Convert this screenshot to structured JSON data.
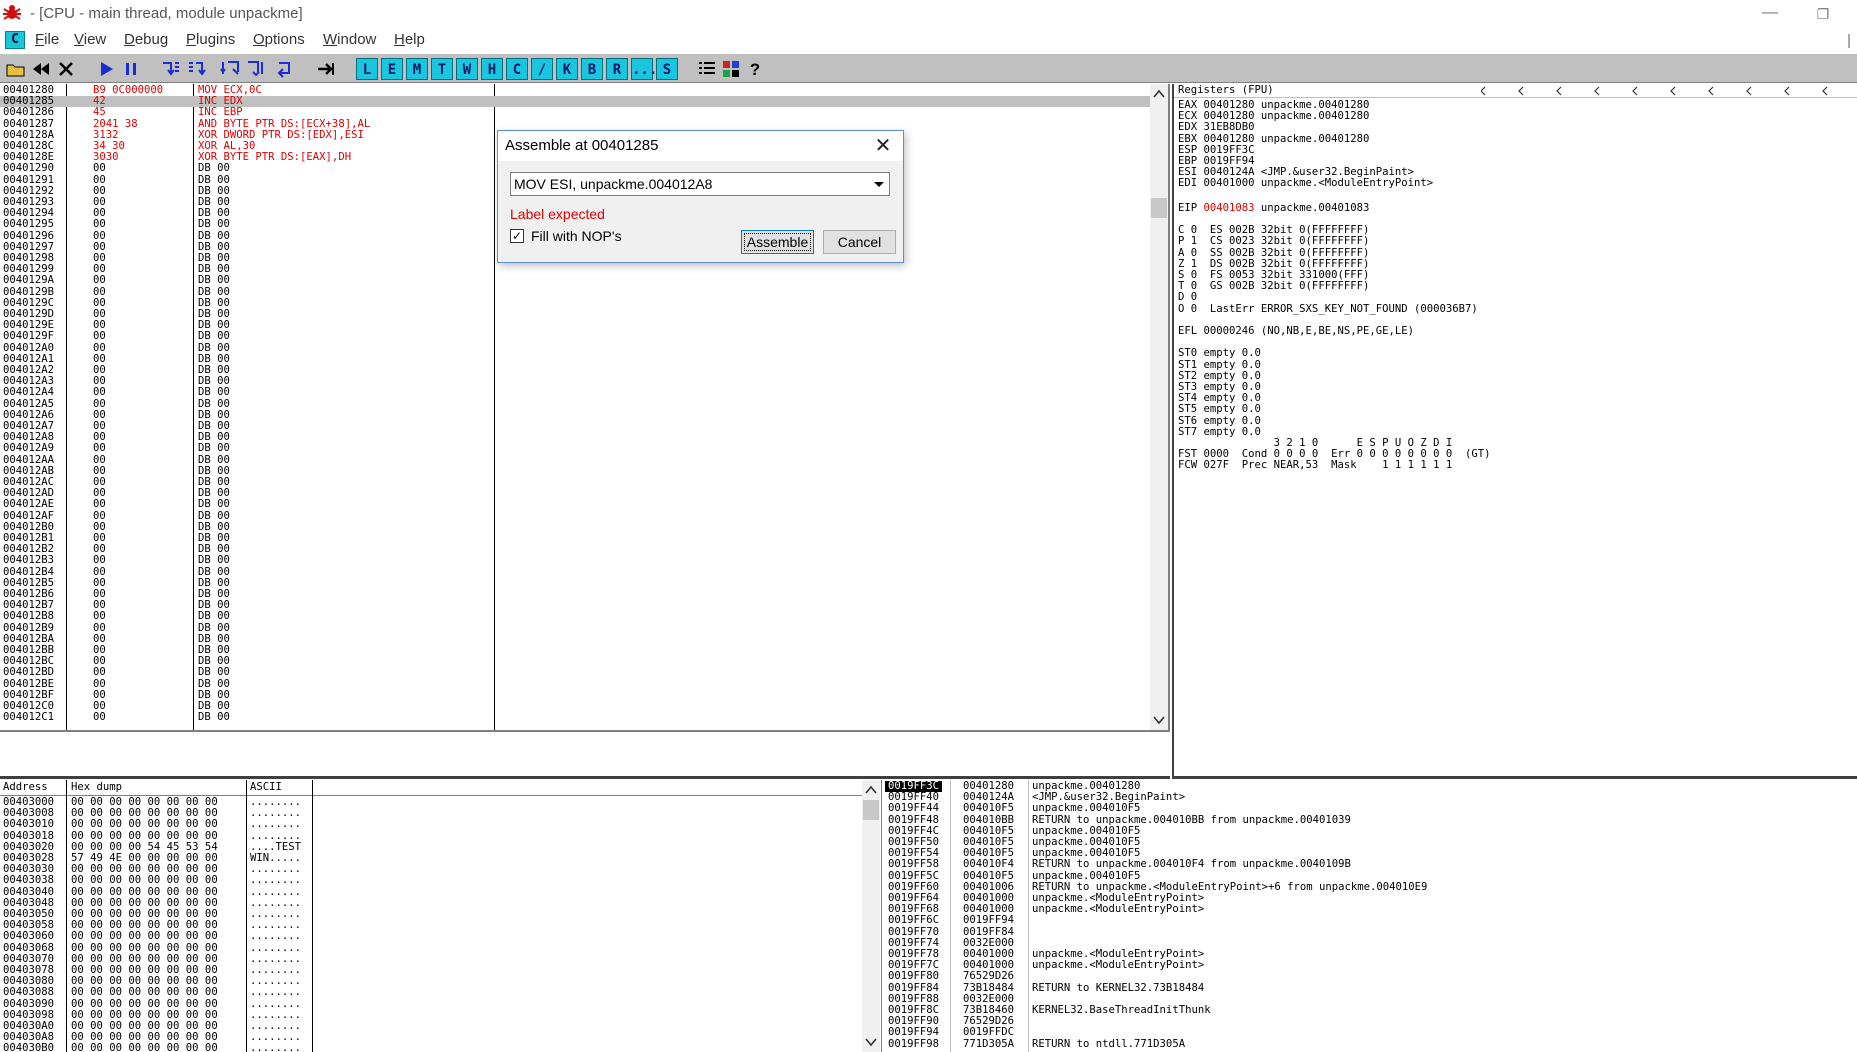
{
  "window": {
    "title": "- [CPU - main thread, module unpackme]",
    "minimize": "—",
    "restore": "❐"
  },
  "menu": {
    "icon_label": "C",
    "items": [
      {
        "first": "F",
        "rest": "ile"
      },
      {
        "first": "V",
        "rest": "iew"
      },
      {
        "first": "D",
        "rest": "ebug"
      },
      {
        "first": "P",
        "rest": "lugins"
      },
      {
        "first": "O",
        "rest": "ptions"
      },
      {
        "first": "W",
        "rest": "indow"
      },
      {
        "first": "H",
        "rest": "elp"
      }
    ]
  },
  "toolbar": {
    "icons": [
      "open-icon",
      "rewind-icon",
      "close-icon",
      "play-icon",
      "pause-icon",
      "step-into-icon",
      "step-over-icon",
      "trace-into-icon",
      "trace-over-icon",
      "execute-till-return-icon",
      "go-to-icon"
    ],
    "letters": [
      "L",
      "E",
      "M",
      "T",
      "W",
      "H",
      "C",
      "/",
      "K",
      "B",
      "R",
      "...",
      "S"
    ],
    "tail_icons": [
      "list-icon",
      "grid-icon",
      "help-icon"
    ]
  },
  "disasm": {
    "rows": [
      [
        "00401280",
        "B9 0C000000",
        "MOV ECX,0C"
      ],
      [
        "00401285",
        "42",
        "INC EDX"
      ],
      [
        "00401286",
        "45",
        "INC EBP"
      ],
      [
        "00401287",
        "2041 38",
        "AND BYTE PTR DS:[ECX+38],AL"
      ],
      [
        "0040128A",
        "3132",
        "XOR DWORD PTR DS:[EDX],ESI"
      ],
      [
        "0040128C",
        "34 30",
        "XOR AL,30"
      ],
      [
        "0040128E",
        "3030",
        "XOR BYTE PTR DS:[EAX],DH"
      ],
      [
        "00401290",
        "00",
        "DB 00"
      ],
      [
        "00401291",
        "00",
        "DB 00"
      ],
      [
        "00401292",
        "00",
        "DB 00"
      ],
      [
        "00401293",
        "00",
        "DB 00"
      ],
      [
        "00401294",
        "00",
        "DB 00"
      ],
      [
        "00401295",
        "00",
        "DB 00"
      ],
      [
        "00401296",
        "00",
        "DB 00"
      ],
      [
        "00401297",
        "00",
        "DB 00"
      ],
      [
        "00401298",
        "00",
        "DB 00"
      ],
      [
        "00401299",
        "00",
        "DB 00"
      ],
      [
        "0040129A",
        "00",
        "DB 00"
      ],
      [
        "0040129B",
        "00",
        "DB 00"
      ],
      [
        "0040129C",
        "00",
        "DB 00"
      ],
      [
        "0040129D",
        "00",
        "DB 00"
      ],
      [
        "0040129E",
        "00",
        "DB 00"
      ],
      [
        "0040129F",
        "00",
        "DB 00"
      ],
      [
        "004012A0",
        "00",
        "DB 00"
      ],
      [
        "004012A1",
        "00",
        "DB 00"
      ],
      [
        "004012A2",
        "00",
        "DB 00"
      ],
      [
        "004012A3",
        "00",
        "DB 00"
      ],
      [
        "004012A4",
        "00",
        "DB 00"
      ],
      [
        "004012A5",
        "00",
        "DB 00"
      ],
      [
        "004012A6",
        "00",
        "DB 00"
      ],
      [
        "004012A7",
        "00",
        "DB 00"
      ],
      [
        "004012A8",
        "00",
        "DB 00"
      ],
      [
        "004012A9",
        "00",
        "DB 00"
      ],
      [
        "004012AA",
        "00",
        "DB 00"
      ],
      [
        "004012AB",
        "00",
        "DB 00"
      ],
      [
        "004012AC",
        "00",
        "DB 00"
      ],
      [
        "004012AD",
        "00",
        "DB 00"
      ],
      [
        "004012AE",
        "00",
        "DB 00"
      ],
      [
        "004012AF",
        "00",
        "DB 00"
      ],
      [
        "004012B0",
        "00",
        "DB 00"
      ],
      [
        "004012B1",
        "00",
        "DB 00"
      ],
      [
        "004012B2",
        "00",
        "DB 00"
      ],
      [
        "004012B3",
        "00",
        "DB 00"
      ],
      [
        "004012B4",
        "00",
        "DB 00"
      ],
      [
        "004012B5",
        "00",
        "DB 00"
      ],
      [
        "004012B6",
        "00",
        "DB 00"
      ],
      [
        "004012B7",
        "00",
        "DB 00"
      ],
      [
        "004012B8",
        "00",
        "DB 00"
      ],
      [
        "004012B9",
        "00",
        "DB 00"
      ],
      [
        "004012BA",
        "00",
        "DB 00"
      ],
      [
        "004012BB",
        "00",
        "DB 00"
      ],
      [
        "004012BC",
        "00",
        "DB 00"
      ],
      [
        "004012BD",
        "00",
        "DB 00"
      ],
      [
        "004012BE",
        "00",
        "DB 00"
      ],
      [
        "004012BF",
        "00",
        "DB 00"
      ],
      [
        "004012C0",
        "00",
        "DB 00"
      ],
      [
        "004012C1",
        "00",
        "DB 00"
      ]
    ]
  },
  "registers": {
    "header": "Registers (FPU)",
    "lines": [
      "EAX 00401280 unpackme.00401280",
      "ECX 00401280 unpackme.00401280",
      "EDX 31EB8DB0",
      "EBX 00401280 unpackme.00401280",
      "ESP 0019FF3C",
      "EBP 0019FF94",
      "ESI 0040124A <JMP.&user32.BeginPaint>",
      "EDI 00401000 unpackme.<ModuleEntryPoint>",
      "",
      "EIP_LINE",
      "",
      "C 0  ES 002B 32bit 0(FFFFFFFF)",
      "P 1  CS 0023 32bit 0(FFFFFFFF)",
      "A 0  SS 002B 32bit 0(FFFFFFFF)",
      "Z 1  DS 002B 32bit 0(FFFFFFFF)",
      "S 0  FS 0053 32bit 331000(FFF)",
      "T 0  GS 002B 32bit 0(FFFFFFFF)",
      "D 0",
      "O 0  LastErr ERROR_SXS_KEY_NOT_FOUND (000036B7)",
      "",
      "EFL 00000246 (NO,NB,E,BE,NS,PE,GE,LE)",
      "",
      "ST0 empty 0.0",
      "ST1 empty 0.0",
      "ST2 empty 0.0",
      "ST3 empty 0.0",
      "ST4 empty 0.0",
      "ST5 empty 0.0",
      "ST6 empty 0.0",
      "ST7 empty 0.0",
      "               3 2 1 0      E S P U O Z D I",
      "FST 0000  Cond 0 0 0 0  Err 0 0 0 0 0 0 0 0  (GT)",
      "FCW 027F  Prec NEAR,53  Mask    1 1 1 1 1 1"
    ],
    "eip_label": "EIP ",
    "eip_value": "00401083",
    "eip_comment": " unpackme.00401083"
  },
  "dump": {
    "headers": [
      "Address",
      "Hex dump",
      "ASCII"
    ],
    "rows": [
      [
        "00403000",
        "00 00 00 00 00 00 00 00",
        "........"
      ],
      [
        "00403008",
        "00 00 00 00 00 00 00 00",
        "........"
      ],
      [
        "00403010",
        "00 00 00 00 00 00 00 00",
        "........"
      ],
      [
        "00403018",
        "00 00 00 00 00 00 00 00",
        "........"
      ],
      [
        "00403020",
        "00 00 00 00 54 45 53 54",
        "....TEST"
      ],
      [
        "00403028",
        "57 49 4E 00 00 00 00 00",
        "WIN....."
      ],
      [
        "00403030",
        "00 00 00 00 00 00 00 00",
        "........"
      ],
      [
        "00403038",
        "00 00 00 00 00 00 00 00",
        "........"
      ],
      [
        "00403040",
        "00 00 00 00 00 00 00 00",
        "........"
      ],
      [
        "00403048",
        "00 00 00 00 00 00 00 00",
        "........"
      ],
      [
        "00403050",
        "00 00 00 00 00 00 00 00",
        "........"
      ],
      [
        "00403058",
        "00 00 00 00 00 00 00 00",
        "........"
      ],
      [
        "00403060",
        "00 00 00 00 00 00 00 00",
        "........"
      ],
      [
        "00403068",
        "00 00 00 00 00 00 00 00",
        "........"
      ],
      [
        "00403070",
        "00 00 00 00 00 00 00 00",
        "........"
      ],
      [
        "00403078",
        "00 00 00 00 00 00 00 00",
        "........"
      ],
      [
        "00403080",
        "00 00 00 00 00 00 00 00",
        "........"
      ],
      [
        "00403088",
        "00 00 00 00 00 00 00 00",
        "........"
      ],
      [
        "00403090",
        "00 00 00 00 00 00 00 00",
        "........"
      ],
      [
        "00403098",
        "00 00 00 00 00 00 00 00",
        "........"
      ],
      [
        "004030A0",
        "00 00 00 00 00 00 00 00",
        "........"
      ],
      [
        "004030A8",
        "00 00 00 00 00 00 00 00",
        "........"
      ],
      [
        "004030B0",
        "00 00 00 00 00 00 00 00",
        "........"
      ]
    ]
  },
  "stack": {
    "rows": [
      [
        "0019FF3C",
        "00401280",
        "unpackme.00401280"
      ],
      [
        "0019FF40",
        "0040124A",
        "<JMP.&user32.BeginPaint>"
      ],
      [
        "0019FF44",
        "004010F5",
        "unpackme.004010F5"
      ],
      [
        "0019FF48",
        "004010BB",
        "RETURN to unpackme.004010BB from unpackme.00401039"
      ],
      [
        "0019FF4C",
        "004010F5",
        "unpackme.004010F5"
      ],
      [
        "0019FF50",
        "004010F5",
        "unpackme.004010F5"
      ],
      [
        "0019FF54",
        "004010F5",
        "unpackme.004010F5"
      ],
      [
        "0019FF58",
        "004010F4",
        "RETURN to unpackme.004010F4 from unpackme.0040109B"
      ],
      [
        "0019FF5C",
        "004010F5",
        "unpackme.004010F5"
      ],
      [
        "0019FF60",
        "00401006",
        "RETURN to unpackme.<ModuleEntryPoint>+6 from unpackme.004010E9"
      ],
      [
        "0019FF64",
        "00401000",
        "unpackme.<ModuleEntryPoint>"
      ],
      [
        "0019FF68",
        "00401000",
        "unpackme.<ModuleEntryPoint>"
      ],
      [
        "0019FF6C",
        "0019FF94",
        ""
      ],
      [
        "0019FF70",
        "0019FF84",
        ""
      ],
      [
        "0019FF74",
        "0032E000",
        ""
      ],
      [
        "0019FF78",
        "00401000",
        "unpackme.<ModuleEntryPoint>"
      ],
      [
        "0019FF7C",
        "00401000",
        "unpackme.<ModuleEntryPoint>"
      ],
      [
        "0019FF80",
        "76529D26",
        ""
      ],
      [
        "0019FF84",
        "73B18484",
        "RETURN to KERNEL32.73B18484"
      ],
      [
        "0019FF88",
        "0032E000",
        ""
      ],
      [
        "0019FF8C",
        "73B18460",
        "KERNEL32.BaseThreadInitThunk"
      ],
      [
        "0019FF90",
        "76529D26",
        ""
      ],
      [
        "0019FF94",
        "0019FFDC",
        ""
      ],
      [
        "0019FF98",
        "771D305A",
        "RETURN to ntdll.771D305A"
      ]
    ]
  },
  "dialog": {
    "title": "Assemble at 00401285",
    "close": "✕",
    "input_value": "MOV ESI, unpackme.004012A8",
    "error": "Label expected",
    "checkbox_label": "Fill with NOP's",
    "checkbox_mark": "✓",
    "assemble_label": "Assemble",
    "cancel_label": "Cancel"
  }
}
